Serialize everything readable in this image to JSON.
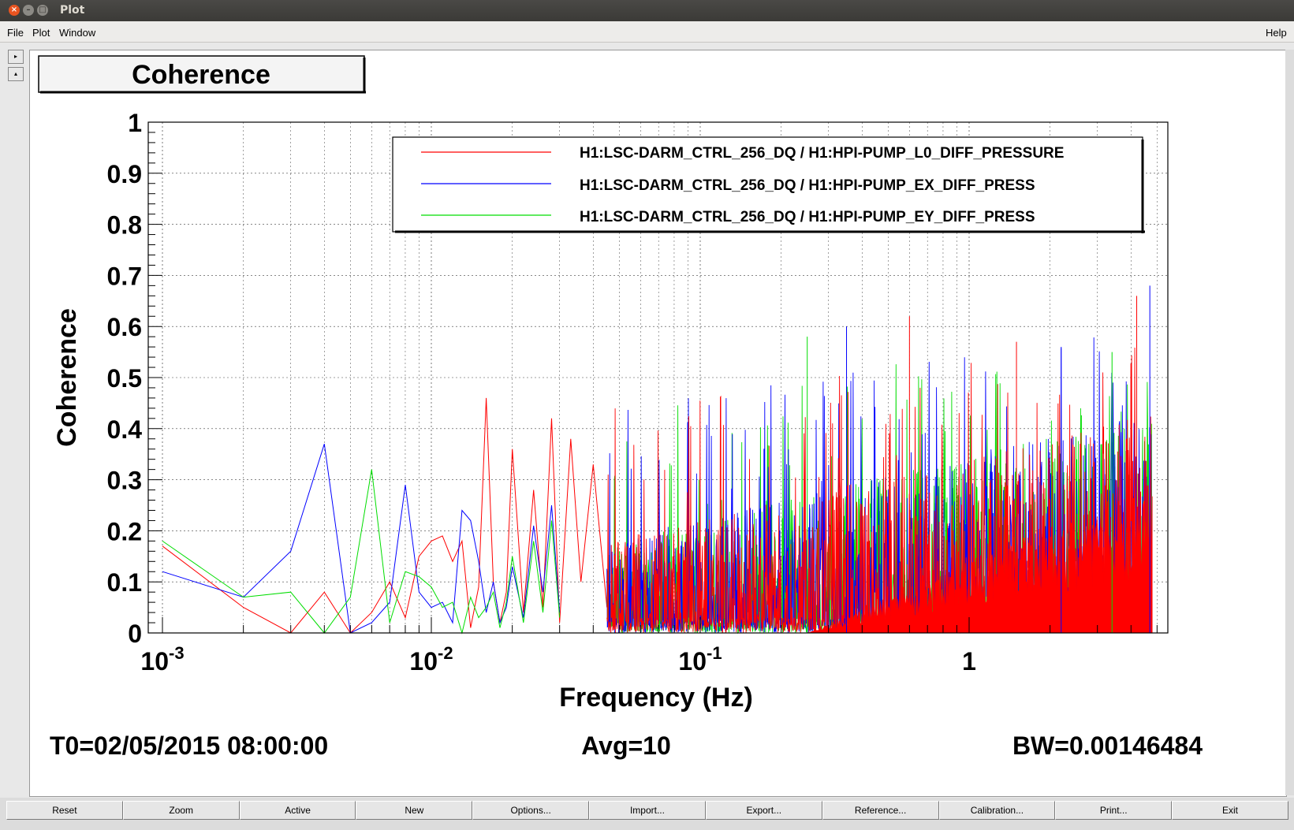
{
  "window": {
    "title": "Plot"
  },
  "menubar": {
    "file": "File",
    "plot": "Plot",
    "window": "Window",
    "help": "Help"
  },
  "side_buttons": {
    "expand": "▸",
    "collapse": "▴"
  },
  "canvas": {
    "title_box": "Coherence",
    "footer": {
      "t0": "T0=02/05/2015 08:00:00",
      "avg": "Avg=10",
      "bw": "BW=0.00146484"
    }
  },
  "buttons": [
    "Reset",
    "Zoom",
    "Active",
    "New",
    "Options...",
    "Import...",
    "Export...",
    "Reference...",
    "Calibration...",
    "Print...",
    "Exit"
  ],
  "chart_data": {
    "type": "line",
    "title": "",
    "xlabel": "Frequency (Hz)",
    "ylabel": "Coherence",
    "xscale": "log",
    "xlim": [
      0.001,
      5
    ],
    "ylim": [
      0,
      1
    ],
    "x_tick_labels": [
      "10",
      "10",
      "10",
      "1"
    ],
    "x_tick_exponents": [
      "-3",
      "-2",
      "-1",
      ""
    ],
    "y_tick_labels": [
      "0",
      "0.1",
      "0.2",
      "0.3",
      "0.4",
      "0.5",
      "0.6",
      "0.7",
      "0.8",
      "0.9",
      "1"
    ],
    "grid": true,
    "legend_position": "top-right",
    "series": [
      {
        "name": "H1:LSC-DARM_CTRL_256_DQ / H1:HPI-PUMP_L0_DIFF_PRESSURE",
        "color": "#ff0000",
        "x": [
          0.001,
          0.002,
          0.003,
          0.004,
          0.005,
          0.006,
          0.007,
          0.008,
          0.009,
          0.01,
          0.011,
          0.012,
          0.013,
          0.014,
          0.015,
          0.016,
          0.017,
          0.018,
          0.019,
          0.02,
          0.022,
          0.024,
          0.026,
          0.028,
          0.03,
          0.033,
          0.036,
          0.04,
          0.045
        ],
        "y": [
          0.17,
          0.05,
          0.0,
          0.08,
          0.0,
          0.04,
          0.1,
          0.03,
          0.15,
          0.18,
          0.19,
          0.14,
          0.18,
          0.01,
          0.09,
          0.46,
          0.1,
          0.02,
          0.08,
          0.36,
          0.04,
          0.28,
          0.05,
          0.42,
          0.02,
          0.38,
          0.1,
          0.33,
          0.05
        ]
      },
      {
        "name": "H1:LSC-DARM_CTRL_256_DQ / H1:HPI-PUMP_EX_DIFF_PRESS",
        "color": "#0000ff",
        "x": [
          0.001,
          0.002,
          0.003,
          0.004,
          0.005,
          0.006,
          0.007,
          0.008,
          0.009,
          0.01,
          0.011,
          0.012,
          0.013,
          0.014,
          0.015,
          0.016,
          0.017,
          0.018,
          0.019,
          0.02,
          0.022,
          0.024,
          0.026,
          0.028,
          0.03
        ],
        "y": [
          0.12,
          0.07,
          0.16,
          0.37,
          0.0,
          0.02,
          0.06,
          0.29,
          0.08,
          0.05,
          0.06,
          0.02,
          0.24,
          0.22,
          0.14,
          0.04,
          0.1,
          0.02,
          0.05,
          0.13,
          0.03,
          0.21,
          0.08,
          0.25,
          0.04
        ]
      },
      {
        "name": "H1:LSC-DARM_CTRL_256_DQ / H1:HPI-PUMP_EY_DIFF_PRESS",
        "color": "#00dd00",
        "x": [
          0.001,
          0.002,
          0.003,
          0.004,
          0.005,
          0.006,
          0.007,
          0.008,
          0.009,
          0.01,
          0.011,
          0.012,
          0.013,
          0.014,
          0.015,
          0.016,
          0.017,
          0.018,
          0.019,
          0.02,
          0.022,
          0.024,
          0.026,
          0.028,
          0.03
        ],
        "y": [
          0.18,
          0.07,
          0.08,
          0.0,
          0.07,
          0.32,
          0.02,
          0.12,
          0.11,
          0.09,
          0.05,
          0.06,
          0.0,
          0.07,
          0.03,
          0.05,
          0.08,
          0.01,
          0.06,
          0.15,
          0.02,
          0.18,
          0.04,
          0.22,
          0.03
        ]
      }
    ],
    "high_frequency_band": {
      "x_start": 0.045,
      "x_end": 4.8,
      "noise_floor_red": 0.3,
      "peak_values": [
        0.62,
        0.6,
        0.58,
        0.57,
        0.56,
        0.55,
        0.66,
        0.68
      ]
    }
  }
}
